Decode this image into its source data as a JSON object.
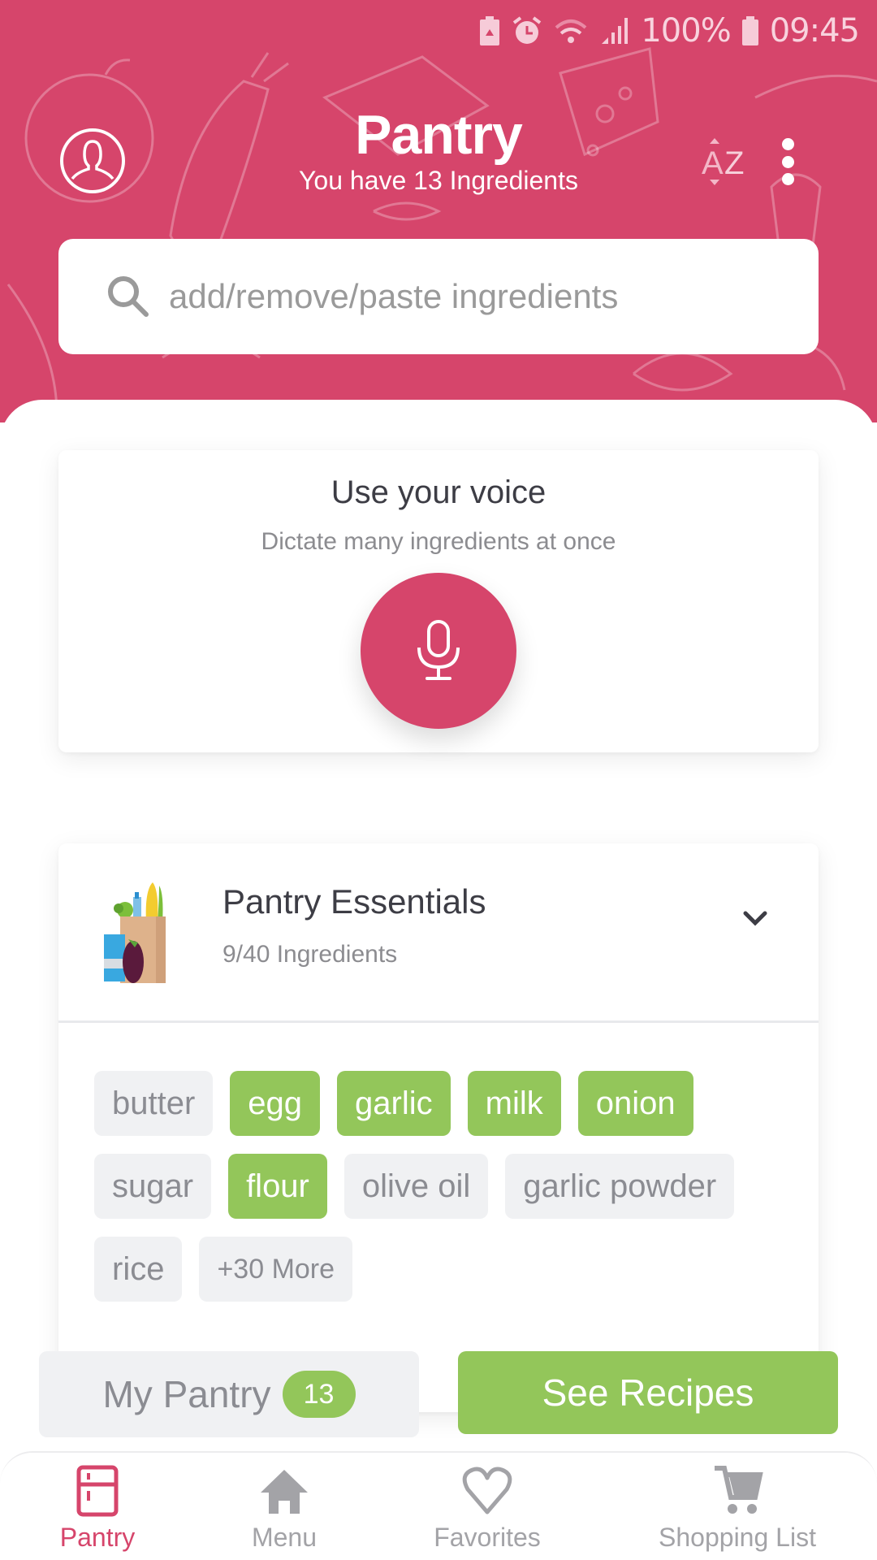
{
  "status_bar": {
    "battery_percent": "100%",
    "time": "09:45",
    "icons": [
      "battery-saver-icon",
      "alarm-icon",
      "wifi-icon",
      "signal-icon",
      "battery-icon"
    ]
  },
  "header": {
    "title": "Pantry",
    "subtitle": "You have 13 Ingredients",
    "avatar_icon": "user-profile-icon",
    "sort_icon": "sort-az-icon",
    "more_icon": "more-vertical-icon"
  },
  "search": {
    "placeholder": "add/remove/paste ingredients",
    "value": "",
    "icon": "search-icon"
  },
  "voice_card": {
    "title": "Use your voice",
    "subtitle": "Dictate many ingredients at once",
    "button_icon": "microphone-icon"
  },
  "essentials": {
    "title": "Pantry Essentials",
    "count_label": "9/40 Ingredients",
    "icon": "grocery-bag-icon",
    "expand_icon": "chevron-down-icon",
    "chips": [
      {
        "label": "butter",
        "selected": false
      },
      {
        "label": "egg",
        "selected": true
      },
      {
        "label": "garlic",
        "selected": true
      },
      {
        "label": "milk",
        "selected": true
      },
      {
        "label": "onion",
        "selected": true
      },
      {
        "label": "sugar",
        "selected": false
      },
      {
        "label": "flour",
        "selected": true
      },
      {
        "label": "olive oil",
        "selected": false
      },
      {
        "label": "garlic powder",
        "selected": false
      },
      {
        "label": "rice",
        "selected": false
      }
    ],
    "more_label": "+30 More"
  },
  "actions": {
    "my_pantry_label": "My Pantry",
    "my_pantry_count": "13",
    "see_recipes_label": "See Recipes"
  },
  "tabs": [
    {
      "label": "Pantry",
      "icon": "fridge-icon",
      "active": true
    },
    {
      "label": "Menu",
      "icon": "home-icon",
      "active": false
    },
    {
      "label": "Favorites",
      "icon": "heart-icon",
      "active": false
    },
    {
      "label": "Shopping List",
      "icon": "cart-icon",
      "active": false
    }
  ],
  "colors": {
    "brand_pink": "#d6456b",
    "selected_green": "#93c65a",
    "chip_gray": "#f0f1f3",
    "text_dark": "#3d3d45",
    "text_muted": "#8c8c90"
  }
}
